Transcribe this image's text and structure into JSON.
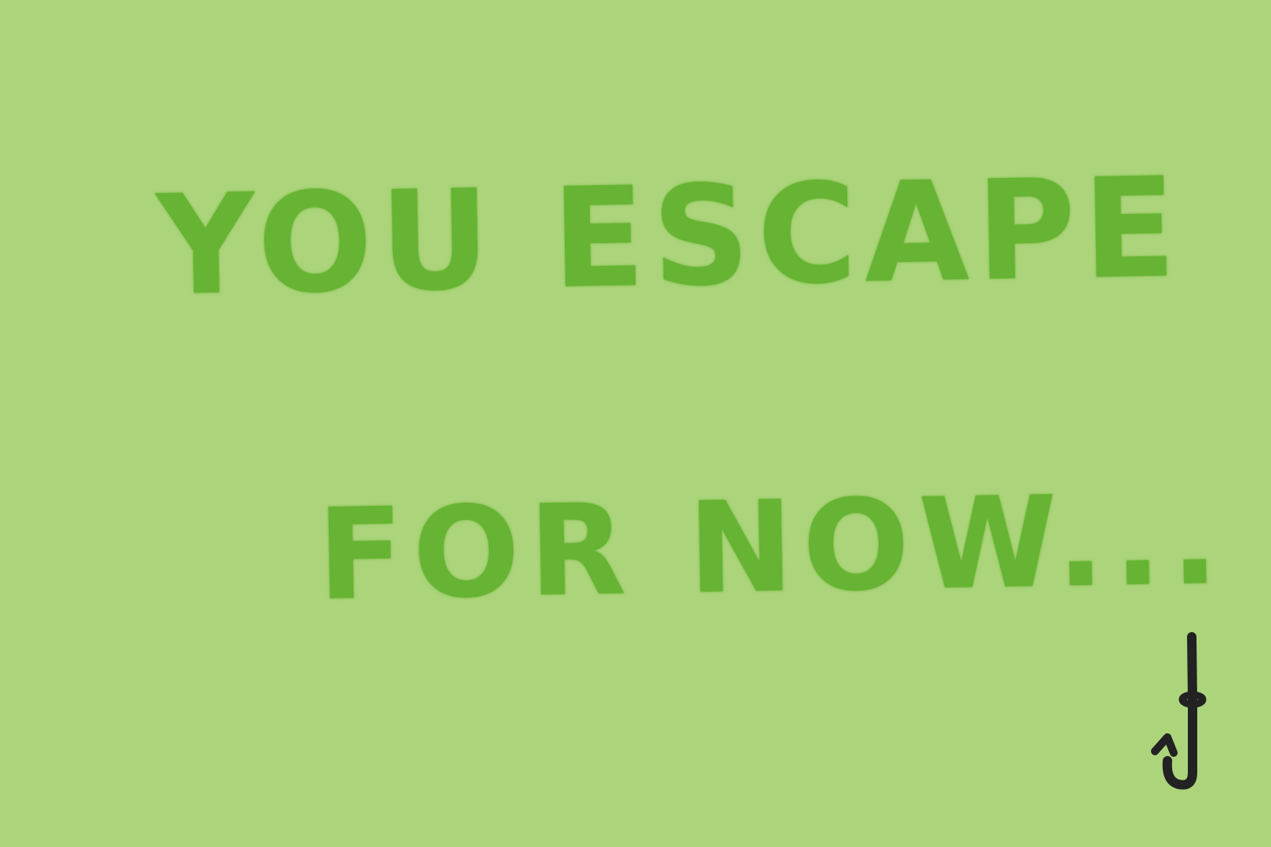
{
  "screen": {
    "background_color": "#acd57b",
    "text_color": "#67b333",
    "line1": "YOU ESCAPE",
    "line2": "FOR NOW..."
  },
  "icons": {
    "hook": "fishing-hook-icon",
    "hook_color": "#222222"
  }
}
